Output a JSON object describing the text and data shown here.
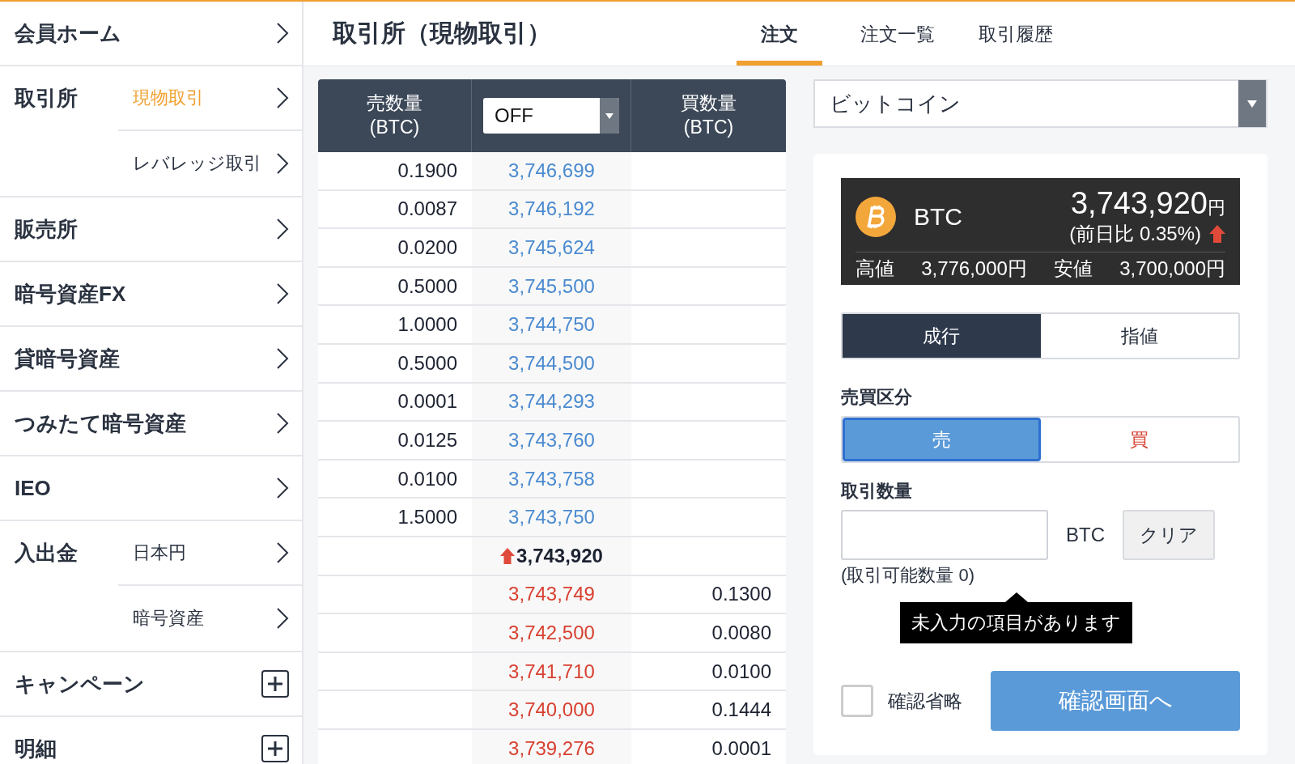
{
  "sidebar": {
    "items": [
      {
        "label": "会員ホーム",
        "kind": "link"
      },
      {
        "label": "取引所",
        "kind": "group",
        "sub_items": [
          {
            "label": "現物取引",
            "selected": true
          },
          {
            "label": "レバレッジ取引",
            "selected": false
          }
        ]
      },
      {
        "label": "販売所",
        "kind": "link"
      },
      {
        "label": "暗号資産FX",
        "kind": "link"
      },
      {
        "label": "貸暗号資産",
        "kind": "link"
      },
      {
        "label": "つみたて暗号資産",
        "kind": "link"
      },
      {
        "label": "IEO",
        "kind": "link"
      },
      {
        "label": "入出金",
        "kind": "group",
        "sub_items": [
          {
            "label": "日本円",
            "selected": false
          },
          {
            "label": "暗号資産",
            "selected": false
          }
        ]
      },
      {
        "label": "キャンペーン",
        "kind": "expand"
      },
      {
        "label": "明細",
        "kind": "expand"
      }
    ]
  },
  "header": {
    "title": "取引所（現物取引）",
    "tabs": [
      {
        "label": "注文",
        "selected": true
      },
      {
        "label": "注文一覧",
        "selected": false
      },
      {
        "label": "取引履歴",
        "selected": false
      }
    ]
  },
  "order_book": {
    "columns": [
      "売数量\n(BTC)",
      "買数量\n(BTC)"
    ],
    "filter": "OFF",
    "rows": [
      {
        "kind": "ask",
        "qty": "0.1900",
        "price": "3,746,699"
      },
      {
        "kind": "ask",
        "qty": "0.0087",
        "price": "3,746,192"
      },
      {
        "kind": "ask",
        "qty": "0.0200",
        "price": "3,745,624"
      },
      {
        "kind": "ask",
        "qty": "0.5000",
        "price": "3,745,500"
      },
      {
        "kind": "ask",
        "qty": "1.0000",
        "price": "3,744,750"
      },
      {
        "kind": "ask",
        "qty": "0.5000",
        "price": "3,744,500"
      },
      {
        "kind": "ask",
        "qty": "0.0001",
        "price": "3,744,293"
      },
      {
        "kind": "ask",
        "qty": "0.0125",
        "price": "3,743,760"
      },
      {
        "kind": "ask",
        "qty": "0.0100",
        "price": "3,743,758"
      },
      {
        "kind": "ask",
        "qty": "1.5000",
        "price": "3,743,750"
      },
      {
        "kind": "last",
        "price": "3,743,920",
        "rising": true
      },
      {
        "kind": "bid",
        "qty": "0.1300",
        "price": "3,743,749"
      },
      {
        "kind": "bid",
        "qty": "0.0080",
        "price": "3,742,500"
      },
      {
        "kind": "bid",
        "qty": "0.0100",
        "price": "3,741,710"
      },
      {
        "kind": "bid",
        "qty": "0.1444",
        "price": "3,740,000"
      },
      {
        "kind": "bid",
        "qty": "0.0001",
        "price": "3,739,276"
      }
    ]
  },
  "coin_select": {
    "value": "ビットコイン"
  },
  "ticker": {
    "symbol": "BTC",
    "price": "3,743,920",
    "unit": "円",
    "change": "(前日比 0.35%)",
    "rising": true,
    "high_label": "高値",
    "high": "3,776,000円",
    "low_label": "安値",
    "low": "3,700,000円"
  },
  "order_types": [
    {
      "label": "成行",
      "selected": true
    },
    {
      "label": "指値",
      "selected": false
    }
  ],
  "side": {
    "label": "売買区分",
    "options": [
      {
        "label": "売",
        "kind": "sell",
        "selected": true
      },
      {
        "label": "買",
        "kind": "buy",
        "selected": false
      }
    ]
  },
  "quantity": {
    "label": "取引数量",
    "unit": "BTC",
    "clear": "クリア",
    "available": "(取引可能数量 0)",
    "tooltip": "未入力の項目があります"
  },
  "skip_confirm": {
    "label": "確認省略",
    "checked": false
  },
  "submit": "確認画面へ"
}
